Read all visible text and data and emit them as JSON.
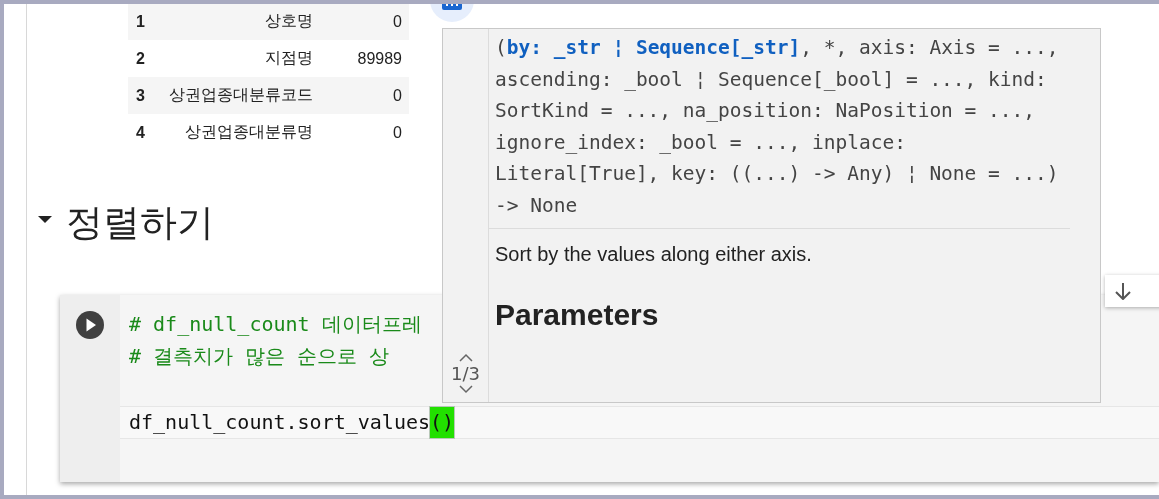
{
  "table": {
    "rows": [
      {
        "index": "1",
        "column_1": "상호명",
        "column_2": "0"
      },
      {
        "index": "2",
        "column_1": "지점명",
        "column_2": "89989"
      },
      {
        "index": "3",
        "column_1": "상권업종대분류코드",
        "column_2": "0"
      },
      {
        "index": "4",
        "column_1": "상권업종대분류명",
        "column_2": "0"
      }
    ]
  },
  "section": {
    "title": "정렬하기",
    "expanded": true
  },
  "code_cell": {
    "lines": [
      {
        "kind": "comment",
        "text": "# df_null_count 데이터프레"
      },
      {
        "kind": "comment",
        "text": "# 결측치가 많은 순으로 상"
      },
      {
        "kind": "blank"
      },
      {
        "kind": "code",
        "text": "df_null_count.sort_values",
        "bracket": "()",
        "bracket_matched": true
      }
    ]
  },
  "tooltip": {
    "signature": {
      "prefix": "(",
      "active_parameter": "by: _str ¦ Sequence[_str]",
      "rest": ", *, axis: Axis = ..., ascending: _bool ¦ Sequence[_bool] = ..., kind: SortKind = ..., na_position: NaPosition = ..., ignore_index: _bool = ..., inplace: Literal[True], key: ((...) -> Any) ¦ None = ...) -> None"
    },
    "description": "Sort by the values along either axis.",
    "heading": "Parameters",
    "page": "1/3"
  }
}
